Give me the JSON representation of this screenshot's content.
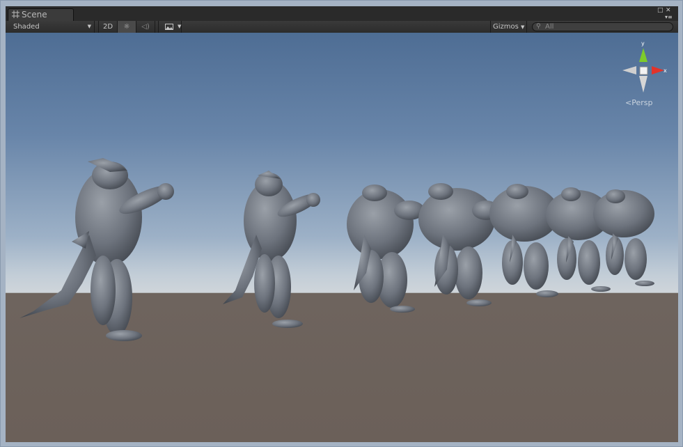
{
  "tab": {
    "title": "Scene",
    "icon": "grid-icon"
  },
  "window_controls": {
    "maximize": "maximize-icon",
    "menu": "menu-icon"
  },
  "toolbar": {
    "draw_mode": "Shaded",
    "mode_2d": "2D",
    "lighting_icon": "sun-icon",
    "audio_icon": "speaker-icon",
    "effects_icon": "image-icon",
    "gizmos": "Gizmos",
    "search_placeholder": "All"
  },
  "gizmo": {
    "y_label": "y",
    "x_label": "x",
    "projection": "Persp",
    "colors": {
      "y": "#7ecb2a",
      "x": "#e2332a",
      "neutral": "#d6d6d6"
    }
  },
  "scene": {
    "sky_top": "#4e6d94",
    "horizon": "#cfd5da",
    "ground": "#6e645e",
    "model_color": "#6d737d",
    "model_count": 7
  }
}
